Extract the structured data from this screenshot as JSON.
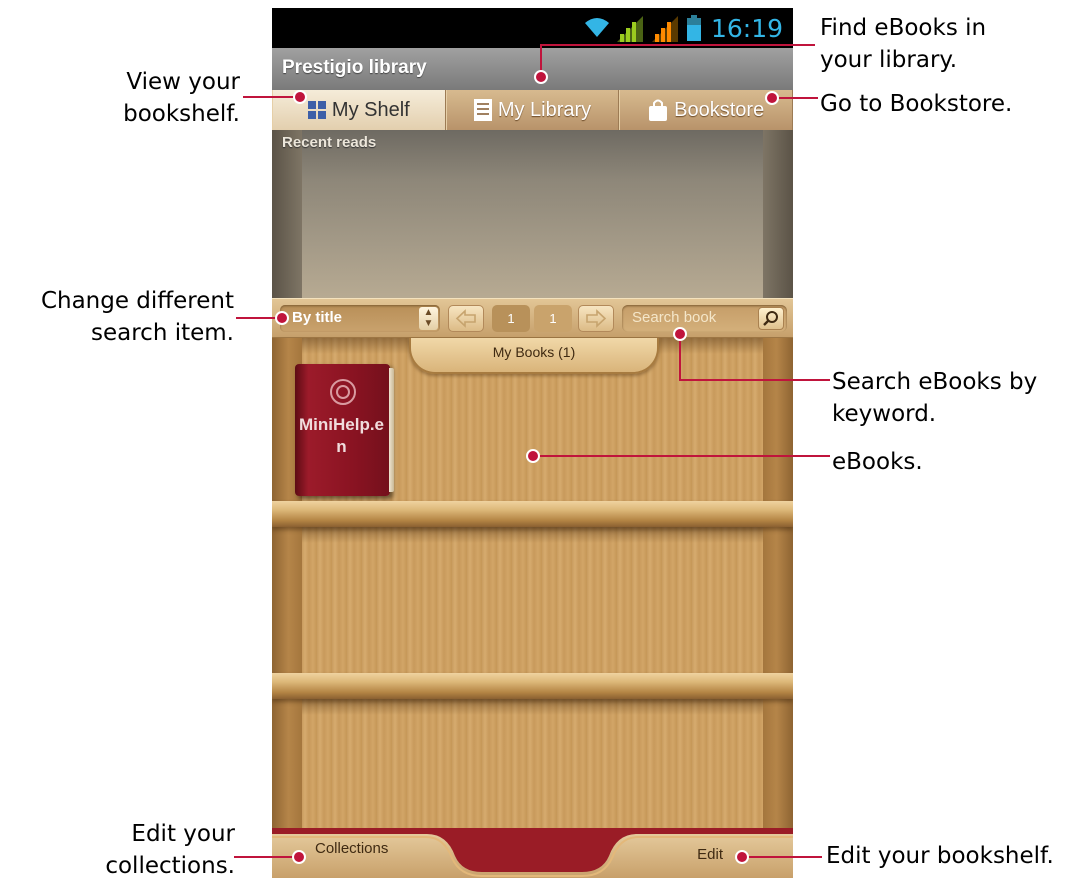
{
  "status_bar": {
    "time": "16:19"
  },
  "app": {
    "title": "Prestigio library"
  },
  "tabs": [
    {
      "label": "My Shelf",
      "icon": "grid-icon",
      "active": true
    },
    {
      "label": "My Library",
      "icon": "list-icon",
      "active": false
    },
    {
      "label": "Bookstore",
      "icon": "shopping-bag-icon",
      "active": false
    }
  ],
  "recent": {
    "label": "Recent reads"
  },
  "search_bar": {
    "sort_value": "By title",
    "current_page": "1",
    "total_pages": "1",
    "search_placeholder": "Search book"
  },
  "shelf": {
    "tab_label": "My Books (1)"
  },
  "books": [
    {
      "title": "MiniHelp.en",
      "cover_color": "#8a1322"
    }
  ],
  "bottom_bar": {
    "collections_label": "Collections",
    "edit_label": "Edit"
  },
  "annotations": {
    "view_bookshelf": "View your bookshelf.",
    "find_ebooks": "Find eBooks in your library.",
    "go_bookstore": "Go to Bookstore.",
    "change_search": "Change different search item.",
    "search_keyword": "Search eBooks by keyword.",
    "ebooks": "eBooks.",
    "edit_collections": "Edit your collections.",
    "edit_bookshelf": "Edit your bookshelf."
  },
  "colors": {
    "callout": "#c0143c",
    "accent_blue": "#33b5e5",
    "signal_green": "#9bcc1f",
    "signal_orange": "#ff8a00"
  }
}
